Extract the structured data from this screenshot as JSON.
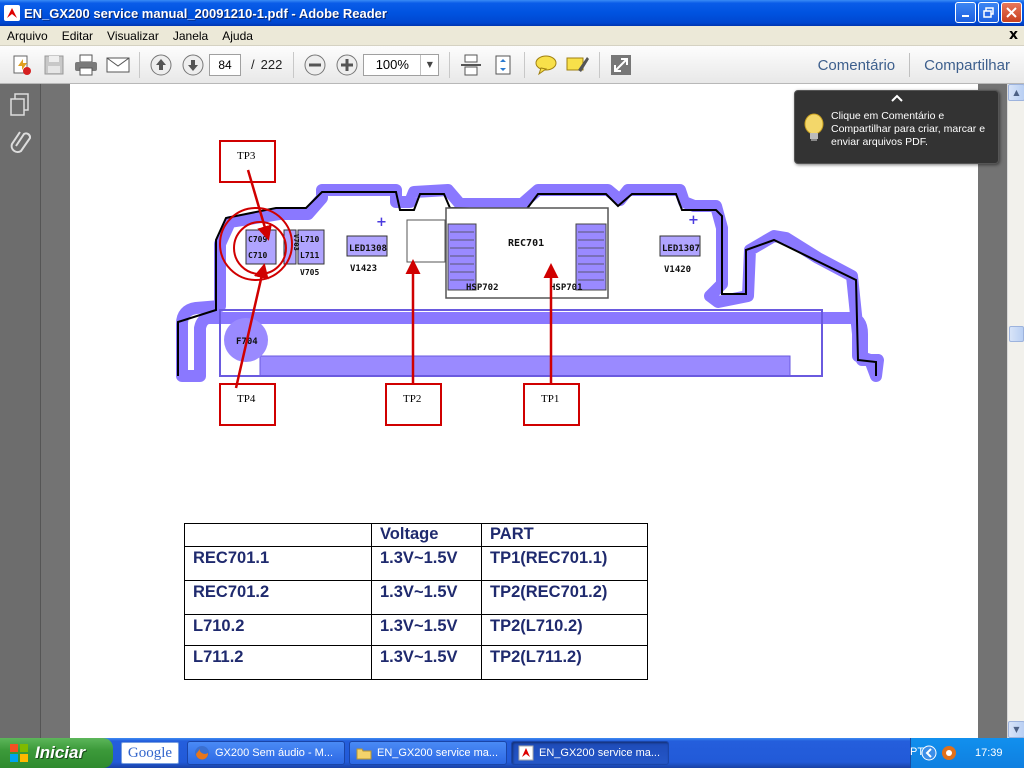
{
  "window": {
    "title": "EN_GX200 service manual_20091210-1.pdf - Adobe Reader",
    "minimize_icon": "minimize-icon",
    "maximize_icon": "restore-icon",
    "close_icon": "close-icon"
  },
  "menu": {
    "items": [
      "Arquivo",
      "Editar",
      "Visualizar",
      "Janela",
      "Ajuda"
    ],
    "doc_close": "x"
  },
  "toolbar": {
    "current_page": "84",
    "page_separator": "/",
    "total_pages": "222",
    "zoom": "100%",
    "comment_label": "Comentário",
    "share_label": "Compartilhar"
  },
  "tooltip": {
    "text": "Clique em Comentário e Compartilhar para criar, marcar e enviar arquivos PDF."
  },
  "diagram": {
    "labels": {
      "tp3": "TP3",
      "tp4": "TP4",
      "tp2": "TP2",
      "tp1": "TP1",
      "rec701": "REC701",
      "hsp702": "HSP702",
      "hsp701": "HSP701",
      "led1308": "LED1308",
      "v1423": "V1423",
      "led1307": "LED1307",
      "v1420": "V1420",
      "c709": "C709",
      "c710": "C710",
      "v703": "V703",
      "l710": "L710",
      "l711": "L711",
      "v705": "V705",
      "f704": "F704"
    },
    "colors": {
      "board": "#8a78ff",
      "outline": "#000000",
      "marker": "#d00000"
    }
  },
  "table": {
    "headers": [
      "",
      "Voltage",
      "PART"
    ],
    "rows": [
      [
        "REC701.1",
        "1.3V~1.5V",
        "TP1(REC701.1)"
      ],
      [
        "REC701.2",
        "1.3V~1.5V",
        "TP2(REC701.2)"
      ],
      [
        "L710.2",
        "1.3V~1.5V",
        "TP2(L710.2)"
      ],
      [
        "L711.2",
        "1.3V~1.5V",
        "TP2(L711.2)"
      ]
    ]
  },
  "taskbar": {
    "start_label": "Iniciar",
    "google_label": "Google",
    "tasks": [
      {
        "label": "GX200 Sem áudio - M...",
        "icon": "firefox-icon"
      },
      {
        "label": "EN_GX200 service ma...",
        "icon": "folder-icon"
      },
      {
        "label": "EN_GX200 service ma...",
        "icon": "pdf-icon"
      }
    ],
    "language": "PT",
    "clock": "17:39"
  }
}
